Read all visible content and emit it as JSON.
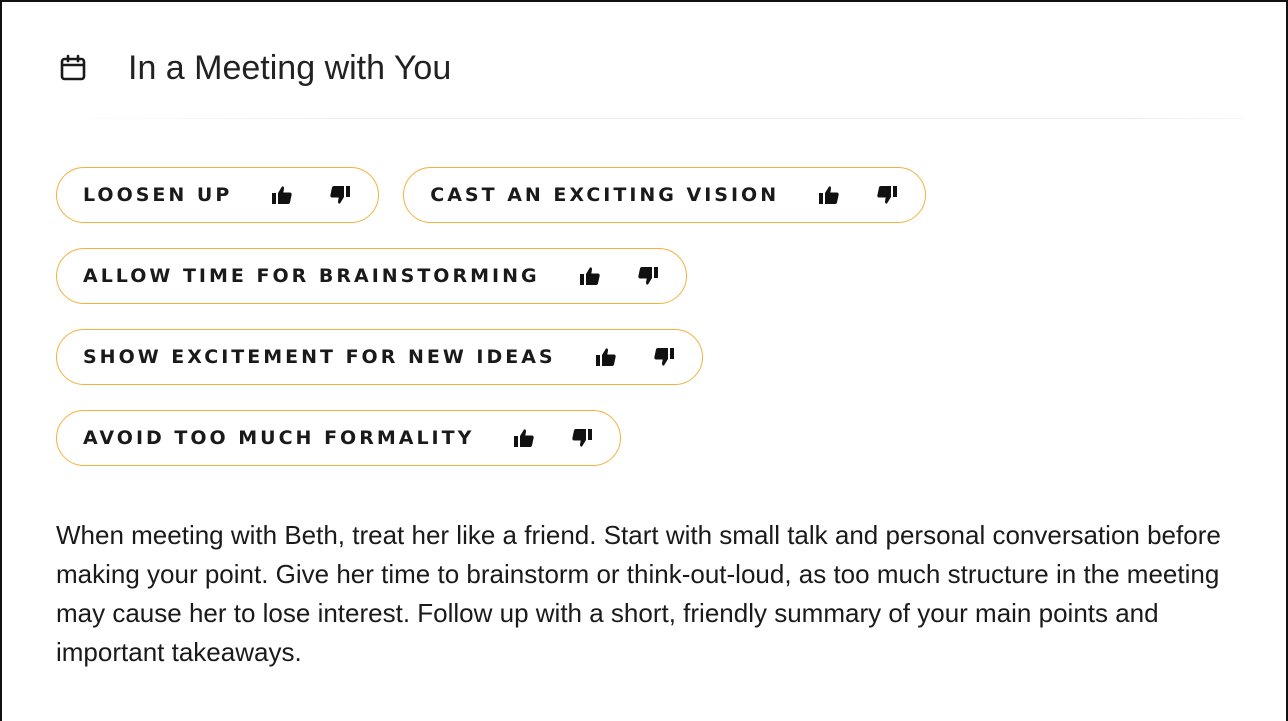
{
  "section": {
    "icon": "calendar-icon",
    "title": "In a Meeting with You"
  },
  "tips": [
    {
      "label": "LOOSEN UP",
      "like_icon": "thumbs-up-icon",
      "dislike_icon": "thumbs-down-icon"
    },
    {
      "label": "CAST AN EXCITING VISION",
      "like_icon": "thumbs-up-icon",
      "dislike_icon": "thumbs-down-icon"
    },
    {
      "label": "ALLOW TIME FOR BRAINSTORMING",
      "like_icon": "thumbs-up-icon",
      "dislike_icon": "thumbs-down-icon"
    },
    {
      "label": "SHOW EXCITEMENT FOR NEW IDEAS",
      "like_icon": "thumbs-up-icon",
      "dislike_icon": "thumbs-down-icon"
    },
    {
      "label": "AVOID TOO MUCH FORMALITY",
      "like_icon": "thumbs-up-icon",
      "dislike_icon": "thumbs-down-icon"
    }
  ],
  "description": "When meeting with Beth, treat her like a friend. Start with small talk and personal conversation before making your point. Give her time to brainstorm or think-out-loud, as too much structure in the meeting may cause her to lose interest. Follow up with a short, friendly summary of your main points and important takeaways.",
  "colors": {
    "pill_border": "#f5b13c",
    "text": "#1a1a1a"
  }
}
